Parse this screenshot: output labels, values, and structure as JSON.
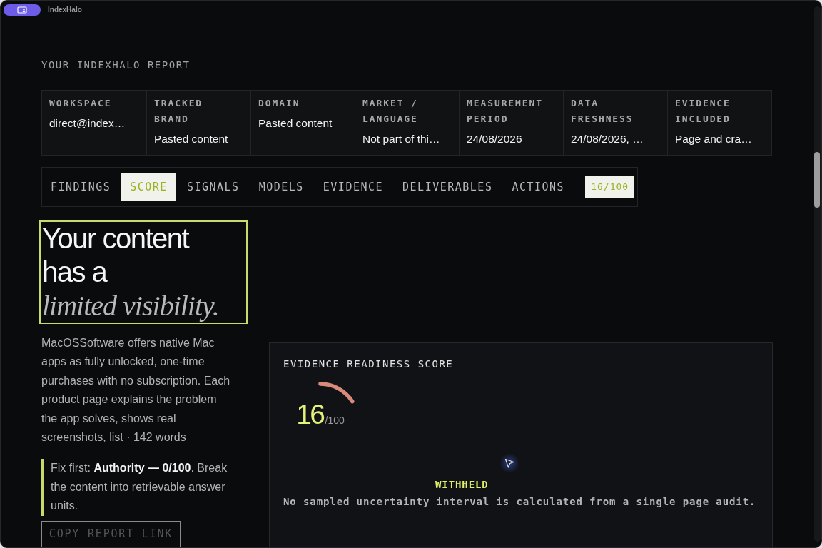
{
  "window": {
    "title": "IndexHalo"
  },
  "report": {
    "heading": "YOUR INDEXHALO REPORT"
  },
  "meta": [
    {
      "label": "WORKSPACE",
      "value": "direct@index…"
    },
    {
      "label": "TRACKED BRAND",
      "value": "Pasted content"
    },
    {
      "label": "DOMAIN",
      "value": "Pasted content"
    },
    {
      "label": "MARKET / LANGUAGE",
      "value": "Not part of thi…"
    },
    {
      "label": "MEASUREMENT PERIOD",
      "value": "24/08/2026"
    },
    {
      "label": "DATA FRESHNESS",
      "value": "24/08/2026, …"
    },
    {
      "label": "EVIDENCE INCLUDED",
      "value": "Page and cra…"
    }
  ],
  "tabs": [
    {
      "label": "FINDINGS",
      "selected": false
    },
    {
      "label": "SCORE",
      "selected": true
    },
    {
      "label": "SIGNALS",
      "selected": false
    },
    {
      "label": "MODELS",
      "selected": false
    },
    {
      "label": "EVIDENCE",
      "selected": false
    },
    {
      "label": "DELIVERABLES",
      "selected": false
    },
    {
      "label": "ACTIONS",
      "selected": false
    }
  ],
  "score_badge": "16/100",
  "headline": "Your content has a *limited visibility.*",
  "summary": "MacOSSoftware offers native Mac apps as fully unlocked, one-time purchases with no subscription. Each product page explains the problem the app solves, shows real screenshots, list · 142 words",
  "callout": "Fix first: **Authority — 0/100**. Break the content into retrievable answer units.",
  "copy_button": "COPY REPORT LINK",
  "score_card": {
    "title": "EVIDENCE READINESS SCORE",
    "score": "16",
    "out_of": "/100",
    "level": 0.16,
    "status": "WITHHELD",
    "note": "No sampled uncertainty interval is calculated from a single page audit."
  }
}
